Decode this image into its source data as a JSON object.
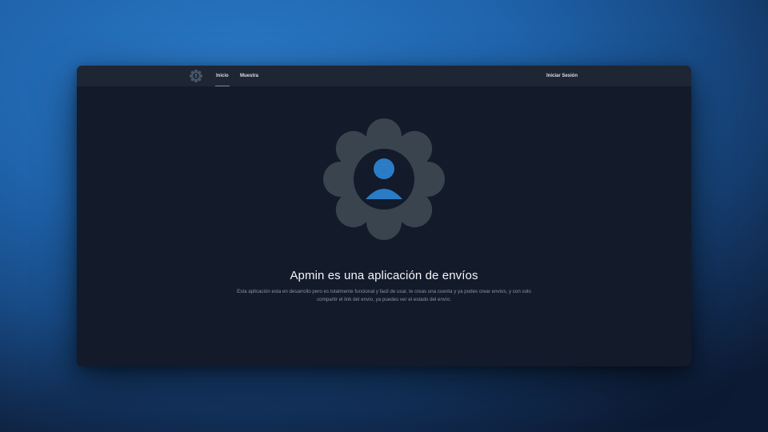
{
  "navbar": {
    "logo_icon": "gear-user-icon",
    "links": [
      {
        "label": "Inicio",
        "active": true
      },
      {
        "label": "Muestra",
        "active": false
      }
    ],
    "login_label": "Iniciar Sesión"
  },
  "hero": {
    "illustration_icon": "gear-user-icon",
    "title": "Apmin es una aplicación de envíos",
    "description": "Esta aplicación esta en desarrollo pero es totalmente funcional y facil de usar, te creas una cuenta y ya podes crear envios, y con solo compartir el link del envío, ya puedes ver el estado del envío."
  },
  "colors": {
    "background_blue": "#1f64ad",
    "window_bg": "#131a2a",
    "navbar_bg": "#1e2633",
    "gear_gray": "#3a444f",
    "accent_blue": "#2a7cc7"
  }
}
